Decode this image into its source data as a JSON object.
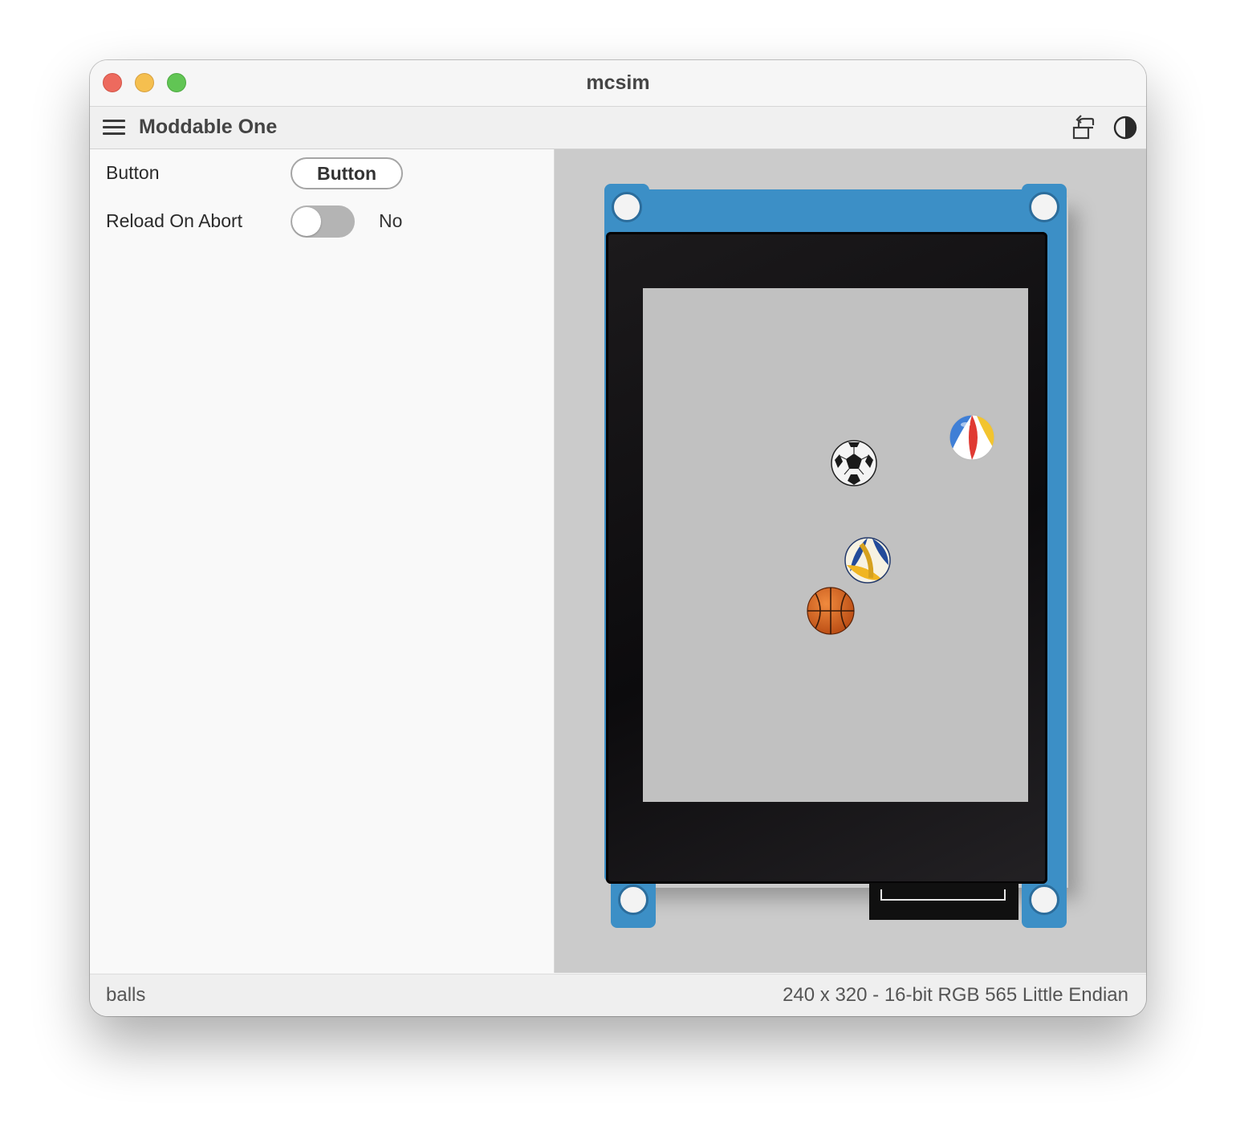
{
  "window": {
    "title": "mcsim"
  },
  "toolbar": {
    "device_name": "Moddable One",
    "icons": [
      "menu-icon",
      "rotate-icon",
      "contrast-icon"
    ]
  },
  "controls": {
    "button_row": {
      "label": "Button",
      "button_label": "Button"
    },
    "reload_row": {
      "label": "Reload On Abort",
      "checked": false,
      "value_text": "No"
    }
  },
  "screen": {
    "background": "#c1c1c1",
    "sprites": [
      "soccer-ball",
      "beach-ball",
      "volleyball",
      "basketball"
    ]
  },
  "status": {
    "app_name": "balls",
    "display_info": "240 x 320 - 16-bit RGB 565 Little Endian"
  },
  "colors": {
    "close": "#ed6a5e",
    "minimize": "#f5bf4f",
    "maximize": "#61c554",
    "pcb": "#3c8fc6"
  }
}
